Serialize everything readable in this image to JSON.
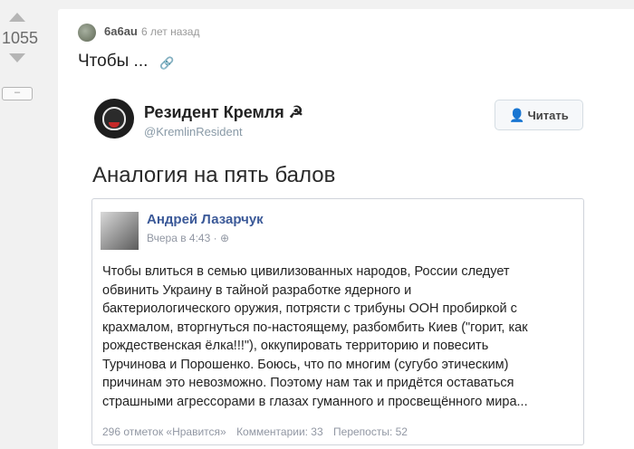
{
  "vote": {
    "score": "1055",
    "collapse_label": "–"
  },
  "post": {
    "author": "6a6au",
    "time": "6 лет назад",
    "title": "Чтобы ..."
  },
  "tweet": {
    "name": "Резидент Кремля ☭",
    "handle": "@KremlinResident",
    "follow_label": "Читать",
    "text": "Аналогия на пять балов",
    "fb": {
      "name": "Андрей Лазарчук",
      "meta": "Вчера в 4:43 · ⊕",
      "lines": [
        "Чтобы влиться в семью цивилизованных народов, России следует",
        "обвинить Украину в тайной разработке ядерного и",
        "бактериологического оружия, потрясти с трибуны ООН пробиркой с",
        "крахмалом, вторгнуться по-настоящему, разбомбить Киев (\"горит, как",
        "рождественская ёлка!!!\"), оккупировать территорию и повесить",
        "Турчинова и Порошенко. Боюсь, что по многим (сугубо этическим)",
        "причинам это невозможно. Поэтому нам так и придётся оставаться",
        "страшными агрессорами в глазах гуманного и просвещённого мира..."
      ],
      "likes": "296 отметок «Нравится»",
      "comments": "Комментарии: 33",
      "shares": "Перепосты: 52"
    }
  },
  "icons": {
    "up": "upvote-arrow",
    "down": "downvote-arrow",
    "link": "link-icon",
    "follow": "add-user-icon"
  }
}
